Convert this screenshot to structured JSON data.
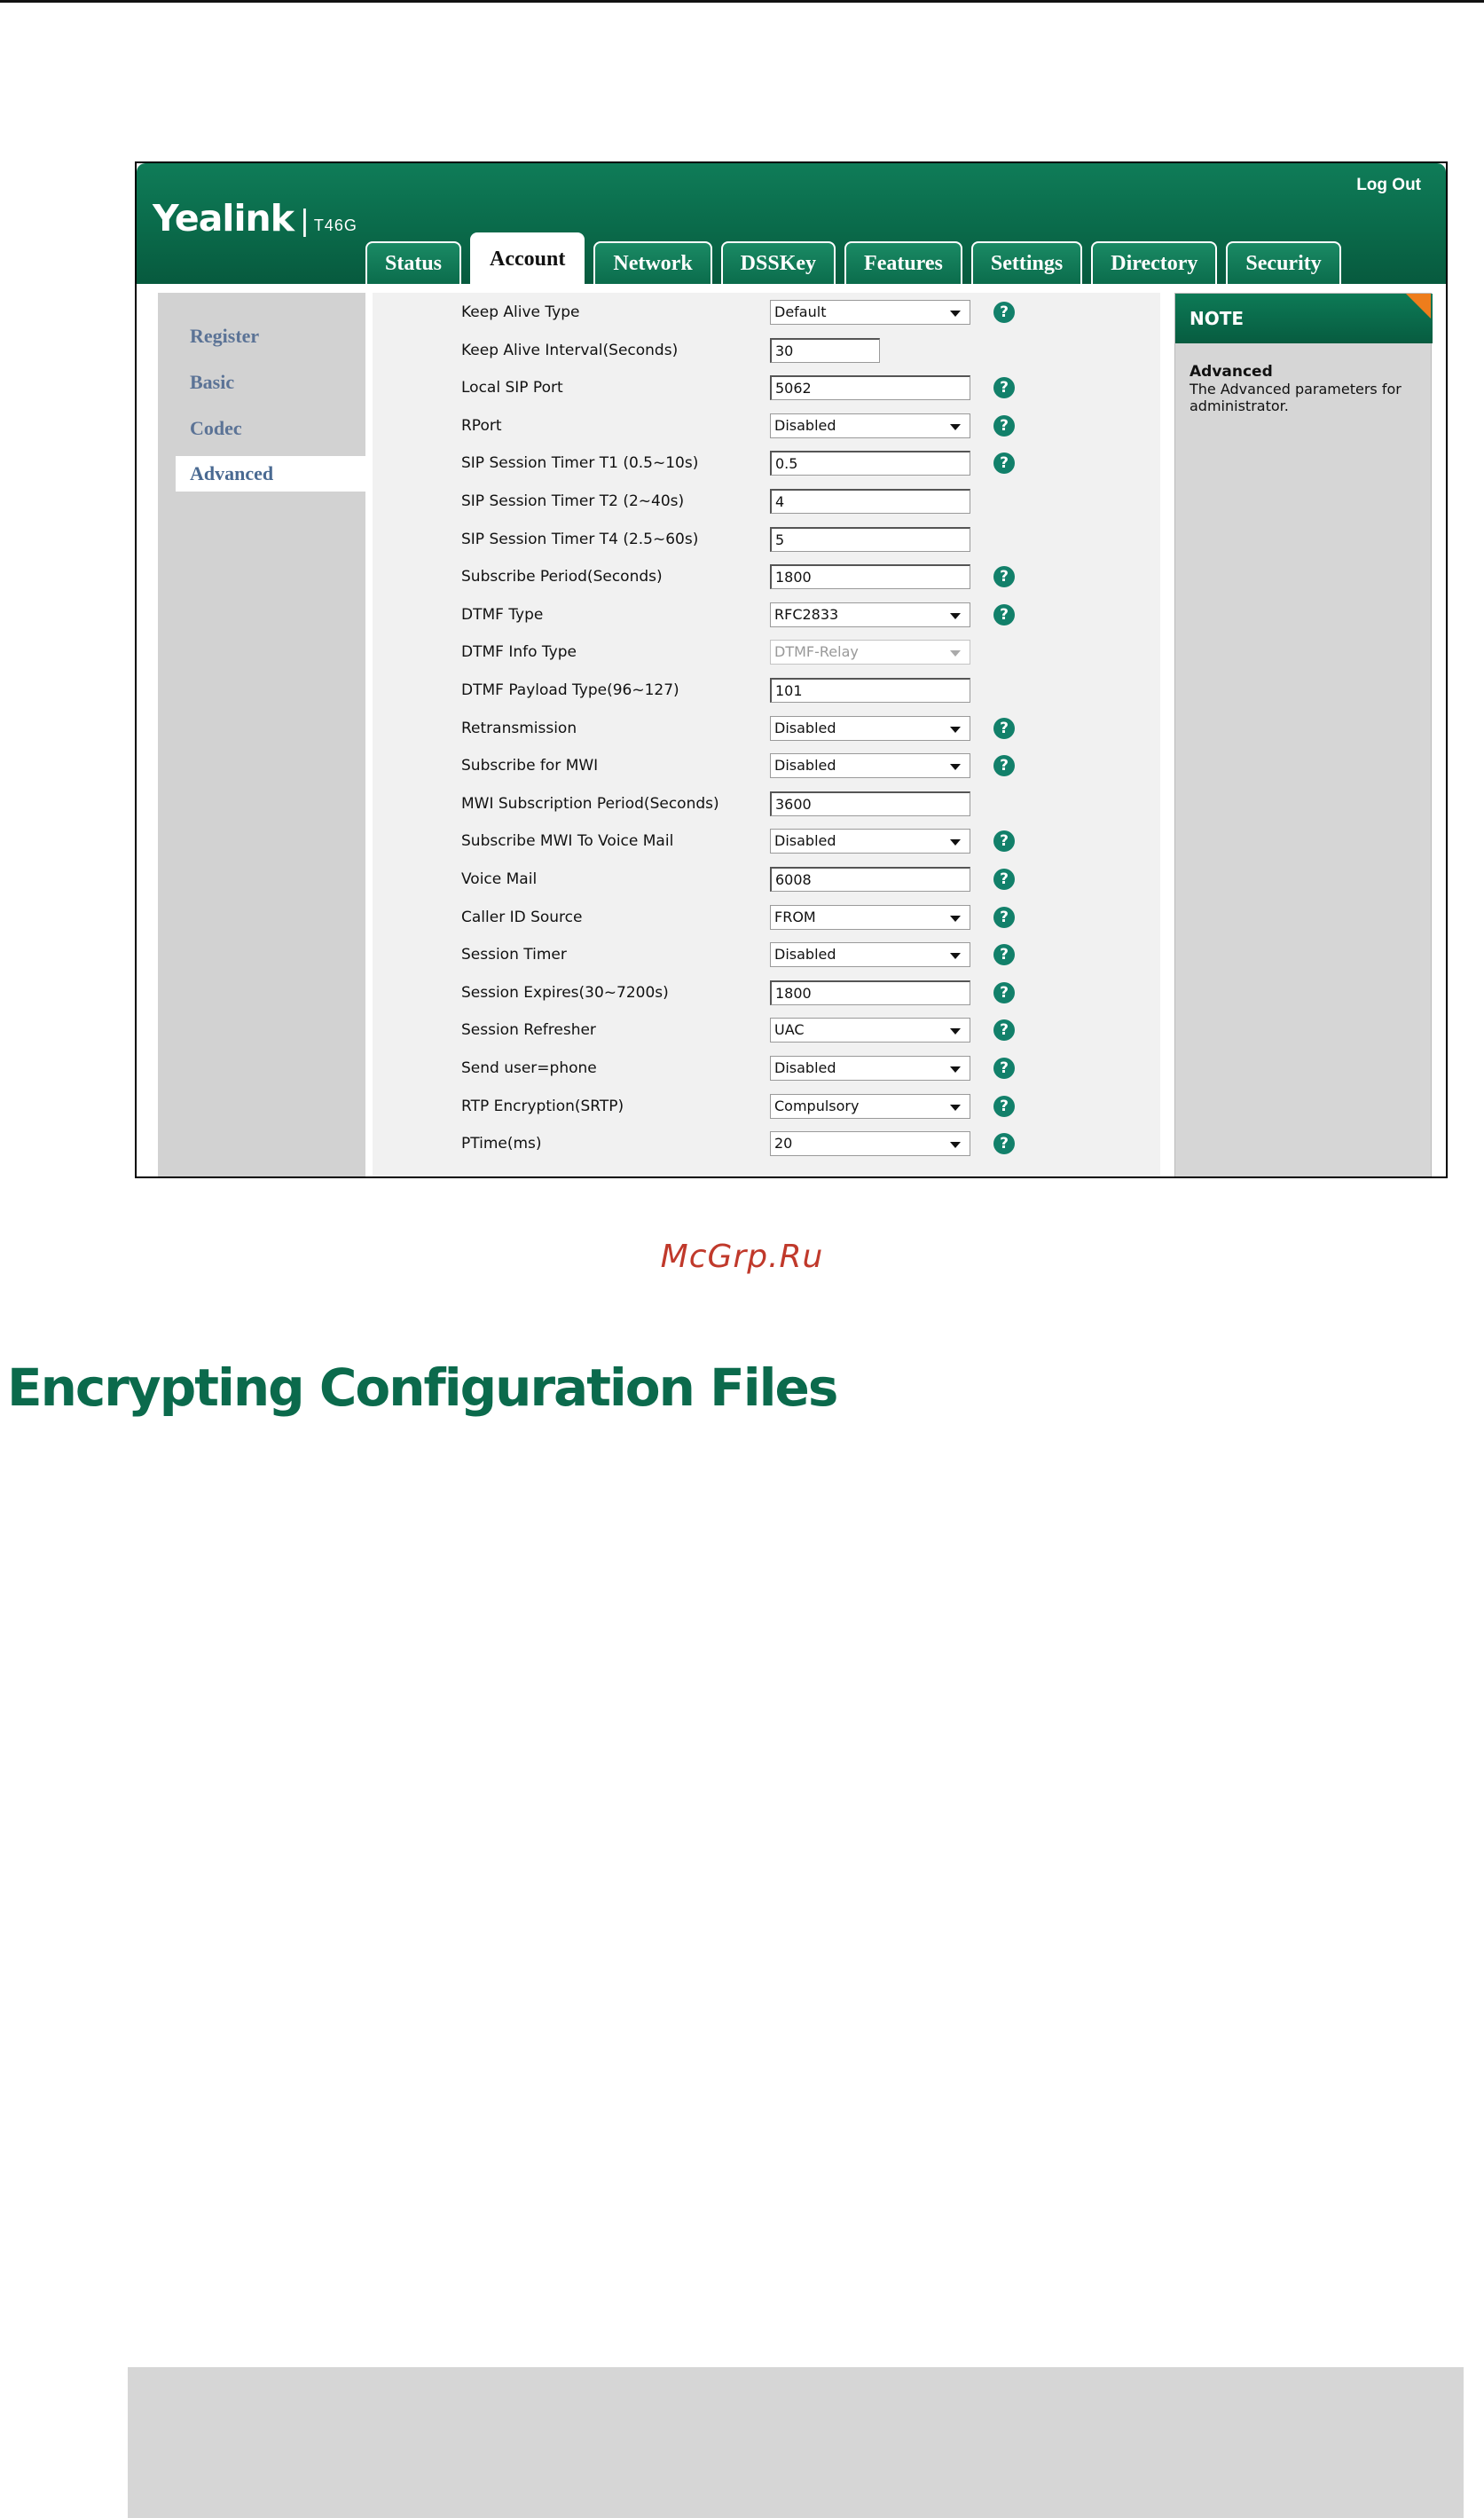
{
  "app": {
    "brand": "Yealink",
    "model": "T46G",
    "logout_label": "Log Out"
  },
  "tabs": [
    {
      "label": "Status",
      "active": false
    },
    {
      "label": "Account",
      "active": true
    },
    {
      "label": "Network",
      "active": false
    },
    {
      "label": "DSSKey",
      "active": false
    },
    {
      "label": "Features",
      "active": false
    },
    {
      "label": "Settings",
      "active": false
    },
    {
      "label": "Directory",
      "active": false
    },
    {
      "label": "Security",
      "active": false
    }
  ],
  "sidebar": {
    "items": [
      {
        "label": "Register",
        "active": false
      },
      {
        "label": "Basic",
        "active": false
      },
      {
        "label": "Codec",
        "active": false
      },
      {
        "label": "Advanced",
        "active": true
      }
    ]
  },
  "form": {
    "rows": [
      {
        "label": "Keep Alive Type",
        "type": "select",
        "value": "Default",
        "help": true
      },
      {
        "label": "Keep Alive Interval(Seconds)",
        "type": "text-short",
        "value": "30",
        "help": false
      },
      {
        "label": "Local SIP Port",
        "type": "text",
        "value": "5062",
        "help": true
      },
      {
        "label": "RPort",
        "type": "select",
        "value": "Disabled",
        "help": true
      },
      {
        "label": "SIP Session Timer T1 (0.5~10s)",
        "type": "text",
        "value": "0.5",
        "help": true
      },
      {
        "label": "SIP Session Timer T2 (2~40s)",
        "type": "text",
        "value": "4",
        "help": false
      },
      {
        "label": "SIP Session Timer T4 (2.5~60s)",
        "type": "text",
        "value": "5",
        "help": false
      },
      {
        "label": "Subscribe Period(Seconds)",
        "type": "text",
        "value": "1800",
        "help": true
      },
      {
        "label": "DTMF Type",
        "type": "select",
        "value": "RFC2833",
        "help": true
      },
      {
        "label": "DTMF Info Type",
        "type": "select-disabled",
        "value": "DTMF-Relay",
        "help": false
      },
      {
        "label": "DTMF Payload Type(96~127)",
        "type": "text",
        "value": "101",
        "help": false
      },
      {
        "label": "Retransmission",
        "type": "select",
        "value": "Disabled",
        "help": true
      },
      {
        "label": "Subscribe for MWI",
        "type": "select",
        "value": "Disabled",
        "help": true
      },
      {
        "label": "MWI Subscription Period(Seconds)",
        "type": "text",
        "value": "3600",
        "help": false
      },
      {
        "label": "Subscribe MWI To Voice Mail",
        "type": "select",
        "value": "Disabled",
        "help": true
      },
      {
        "label": "Voice Mail",
        "type": "text",
        "value": "6008",
        "help": true
      },
      {
        "label": "Caller ID Source",
        "type": "select",
        "value": "FROM",
        "help": true
      },
      {
        "label": "Session Timer",
        "type": "select",
        "value": "Disabled",
        "help": true
      },
      {
        "label": "Session Expires(30~7200s)",
        "type": "text",
        "value": "1800",
        "help": true
      },
      {
        "label": "Session Refresher",
        "type": "select",
        "value": "UAC",
        "help": true
      },
      {
        "label": "Send user=phone",
        "type": "select",
        "value": "Disabled",
        "help": true
      },
      {
        "label": "RTP Encryption(SRTP)",
        "type": "select",
        "value": "Compulsory",
        "help": true
      },
      {
        "label": "PTime(ms)",
        "type": "select",
        "value": "20",
        "help": true
      }
    ]
  },
  "note": {
    "header": "NOTE",
    "title": "Advanced",
    "body": "The Advanced parameters for administrator."
  },
  "watermark": "McGrp.Ru",
  "heading": "Encrypting Configuration Files",
  "colors": {
    "brand_green": "#0b6a4c",
    "note_corner": "#ee7d1c",
    "help_icon": "#12806a",
    "sidebar_text": "#5b7396"
  }
}
